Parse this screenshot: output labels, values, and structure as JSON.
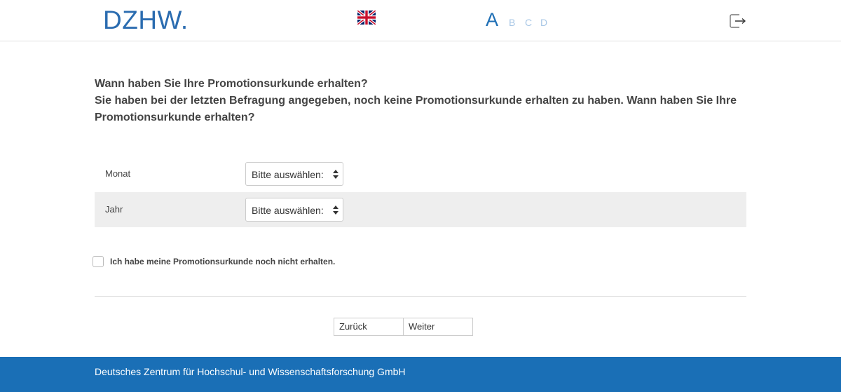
{
  "header": {
    "logo_text": "DZHW.",
    "language_flag": "uk-flag-icon",
    "progress_letters": {
      "current": "A",
      "others": [
        "B",
        "C",
        "D"
      ]
    },
    "logout_icon": "logout-icon"
  },
  "question": {
    "line1": "Wann haben Sie Ihre Promotionsurkunde erhalten?",
    "line2": "Sie haben bei der letzten Befragung angegeben, noch keine Promotionsurkunde erhalten zu haben. Wann haben Sie Ihre Promotionsurkunde erhalten?"
  },
  "fields": [
    {
      "label": "Monat",
      "select_value": "Bitte auswählen:"
    },
    {
      "label": "Jahr",
      "select_value": "Bitte auswählen:"
    }
  ],
  "checkbox": {
    "label": "Ich habe meine Promotionsurkunde noch nicht erhalten.",
    "checked": false
  },
  "nav": {
    "back_label": "Zurück",
    "next_label": "Weiter"
  },
  "footer": {
    "text": "Deutsches Zentrum für Hochschul- und Wissenschaftsforschung GmbH"
  },
  "colors": {
    "brand": "#1a6fb6",
    "logo": "#2b6cb0",
    "letter_inactive": "#a8c7e6"
  }
}
